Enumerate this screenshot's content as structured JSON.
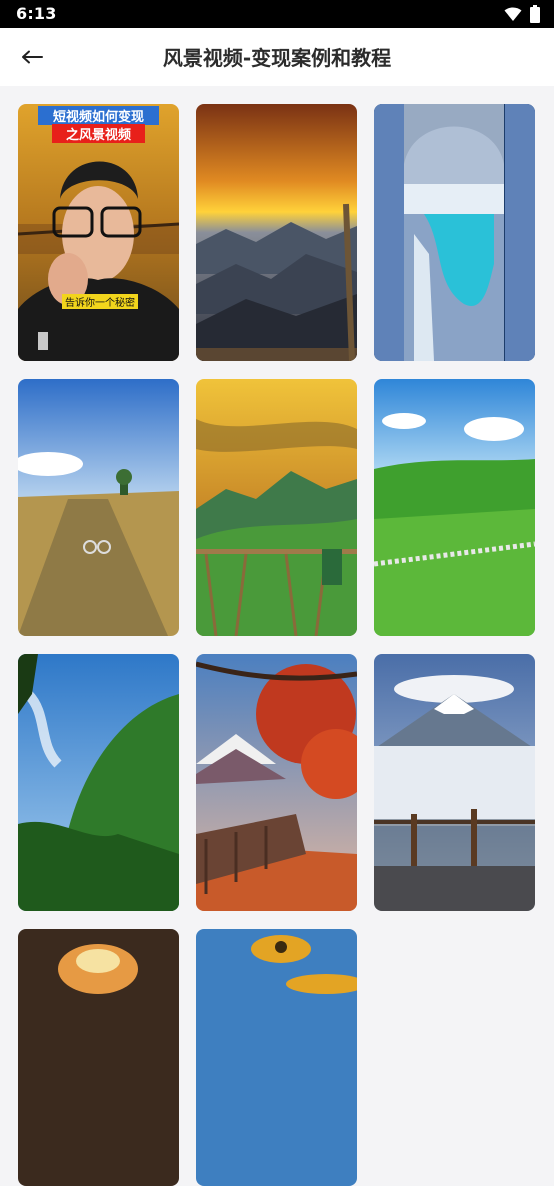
{
  "status_bar": {
    "time": "6:13",
    "icons": [
      "wifi-icon",
      "battery-icon"
    ]
  },
  "header": {
    "back_icon": "arrow-left-icon",
    "title": "风景视频-变现案例和教程"
  },
  "videos": [
    {
      "name": "video-tile-1",
      "overlay_title_line1": "短视频如何变现",
      "overlay_title_line2": "之风景视频",
      "overlay_caption": "告诉你一个秘密",
      "colors": [
        "#d99a2a",
        "#3c2c1c"
      ]
    },
    {
      "name": "video-tile-2",
      "colors": [
        "#b8581a",
        "#2b3346"
      ]
    },
    {
      "name": "video-tile-3",
      "colors": [
        "#5f7eaa",
        "#1a3d6b"
      ]
    },
    {
      "name": "video-tile-4",
      "colors": [
        "#4b82cc",
        "#b59658"
      ]
    },
    {
      "name": "video-tile-5",
      "colors": [
        "#d8a934",
        "#3f8a3a"
      ]
    },
    {
      "name": "video-tile-6",
      "colors": [
        "#4a98d8",
        "#5ca53a"
      ]
    },
    {
      "name": "video-tile-7",
      "colors": [
        "#4fa0e4",
        "#2a5a20"
      ]
    },
    {
      "name": "video-tile-8",
      "colors": [
        "#c0391f",
        "#6a4a3a"
      ]
    },
    {
      "name": "video-tile-9",
      "colors": [
        "#6b8fbf",
        "#d7dde6"
      ]
    },
    {
      "name": "video-tile-10",
      "colors": [
        "#6b4a34",
        "#e08a3a"
      ]
    },
    {
      "name": "video-tile-11",
      "colors": [
        "#3e7fc0",
        "#e3a424"
      ]
    }
  ]
}
